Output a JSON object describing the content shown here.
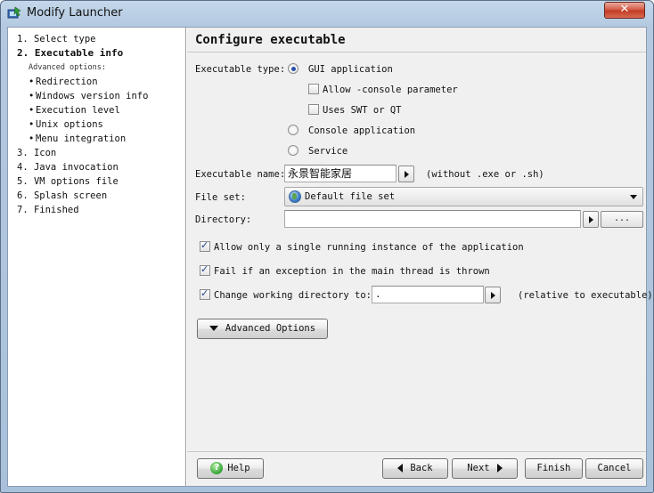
{
  "window": {
    "title": "Modify Launcher",
    "close_glyph": "✕",
    "icon": "launcher-app-icon"
  },
  "nav": {
    "steps": [
      {
        "label": "1. Select type",
        "active": false
      },
      {
        "label": "2. Executable info",
        "active": true
      },
      {
        "label": "3. Icon",
        "active": false
      },
      {
        "label": "4. Java invocation",
        "active": false
      },
      {
        "label": "5. VM options file",
        "active": false
      },
      {
        "label": "6. Splash screen",
        "active": false
      },
      {
        "label": "7. Finished",
        "active": false
      }
    ],
    "advanced_header": "Advanced options:",
    "advanced_items": [
      "Redirection",
      "Windows version info",
      "Execution level",
      "Unix options",
      "Menu integration"
    ],
    "bullet": "•"
  },
  "main": {
    "title": "Configure executable",
    "executable_type": {
      "label": "Executable type:",
      "options": [
        {
          "label": "GUI application",
          "selected": true
        },
        {
          "label": "Console application",
          "selected": false
        },
        {
          "label": "Service",
          "selected": false
        }
      ],
      "gui_suboptions": [
        {
          "label": "Allow -console parameter",
          "checked": false
        },
        {
          "label": "Uses SWT or QT",
          "checked": false
        }
      ]
    },
    "executable_name": {
      "label": "Executable name:",
      "value": "永景智能家居",
      "hint": "(without .exe or .sh)"
    },
    "file_set": {
      "label": "File set:",
      "value": "Default file set",
      "icon": "globe-icon"
    },
    "directory": {
      "label": "Directory:",
      "value": "",
      "browse_label": "..."
    },
    "options": [
      {
        "label": "Allow only a single running instance of the application",
        "checked": true
      },
      {
        "label": "Fail if an exception in the main thread is thrown",
        "checked": true
      },
      {
        "label": "Change working directory to:",
        "checked": true
      }
    ],
    "working_dir": {
      "value": ".",
      "hint": "(relative to executable)"
    },
    "advanced_button": "Advanced Options"
  },
  "buttons": {
    "help": "Help",
    "back": "Back",
    "next": "Next",
    "finish": "Finish",
    "cancel": "Cancel"
  }
}
